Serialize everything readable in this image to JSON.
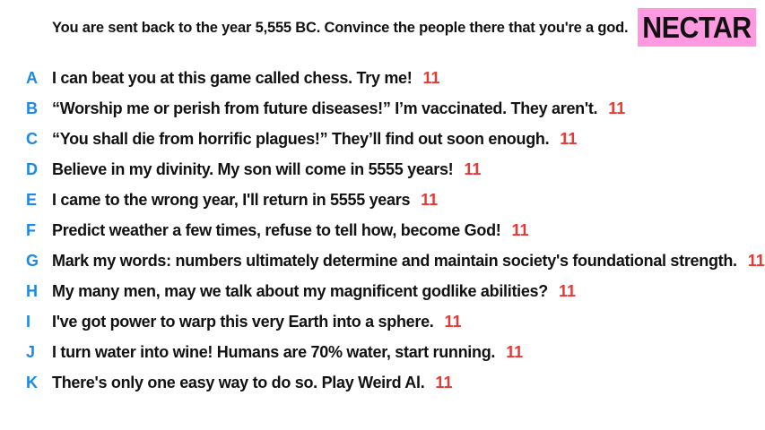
{
  "prompt": "You are sent back to the year 5,555 BC. Convince the people there that you're a god.",
  "logo": {
    "text": "NECTAR",
    "background": "#ff99e0"
  },
  "colors": {
    "letter": "#1e88e5",
    "score": "#e53935",
    "text": "#111111"
  },
  "answers": [
    {
      "letter": "A",
      "text": "I can beat you at this game called chess. Try me!",
      "score": "11"
    },
    {
      "letter": "B",
      "text": "“Worship me or perish from future diseases!” I’m vaccinated. They aren't.",
      "score": "11"
    },
    {
      "letter": "C",
      "text": "“You shall die from horrific plagues!” They’ll find out soon enough.",
      "score": "11"
    },
    {
      "letter": "D",
      "text": "Believe in my divinity. My son will come in 5555 years!",
      "score": "11"
    },
    {
      "letter": "E",
      "text": "I came to the wrong year, I'll return in 5555 years",
      "score": "11"
    },
    {
      "letter": "F",
      "text": "Predict weather a few times, refuse to tell how, become God!",
      "score": "11"
    },
    {
      "letter": "G",
      "text": "Mark my words: numbers ultimately determine and maintain society's foundational strength.",
      "score": "11"
    },
    {
      "letter": "H",
      "text": "My many men, may we talk about my magnificent godlike abilities?",
      "score": "11"
    },
    {
      "letter": "I",
      "text": "I've got power to warp this very Earth into a sphere.",
      "score": "11"
    },
    {
      "letter": "J",
      "text": "I turn water into wine! Humans are 70% water, start running.",
      "score": "11"
    },
    {
      "letter": "K",
      "text": "There's only one easy way to do so. Play Weird Al.",
      "score": "11"
    }
  ]
}
